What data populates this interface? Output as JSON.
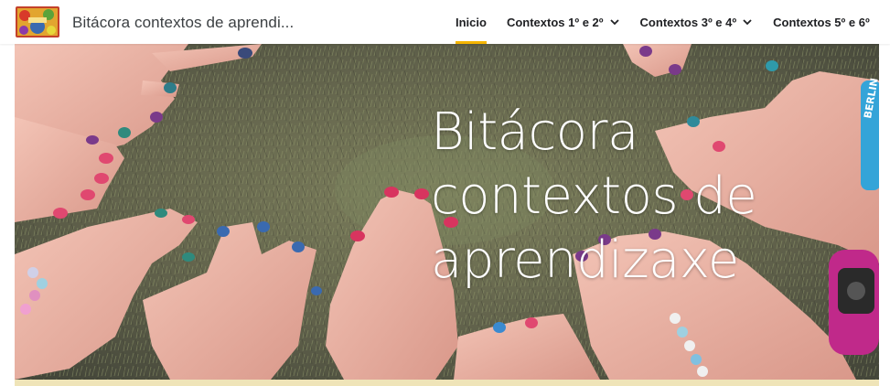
{
  "site": {
    "title": "Bitácora contextos de aprendi...",
    "logo_icon": "site-logo-icon"
  },
  "nav": {
    "items": [
      {
        "label": "Inicio",
        "active": true,
        "has_dropdown": false
      },
      {
        "label": "Contextos 1º e 2º",
        "active": false,
        "has_dropdown": true
      },
      {
        "label": "Contextos 3º e 4º",
        "active": false,
        "has_dropdown": true
      },
      {
        "label": "Contextos 5º e 6º",
        "active": false,
        "has_dropdown": false
      }
    ],
    "active_color": "#f4b400",
    "dropdown_icon": "chevron-down-icon"
  },
  "hero": {
    "title_lines": [
      "Bitácora",
      "contextos de",
      "aprendizaxe"
    ],
    "bracelet_text": "BERLIN",
    "image_icon": "hands-on-grass-photo"
  }
}
